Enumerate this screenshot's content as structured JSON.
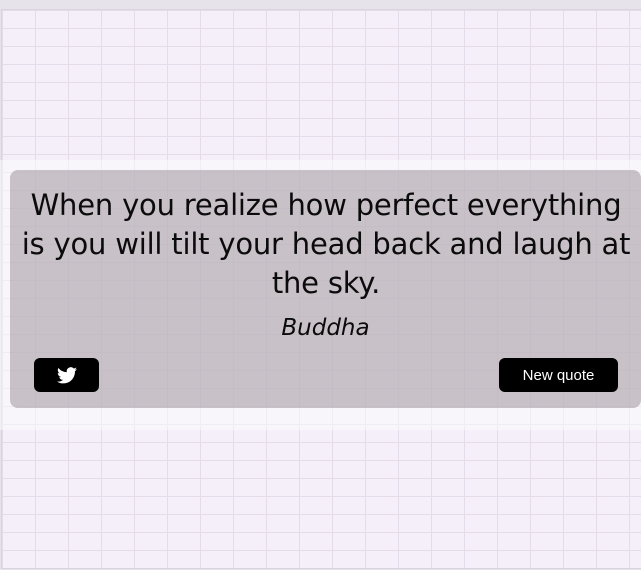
{
  "quote": {
    "text": "When you realize how perfect everything is you will tilt your head back and laugh at the sky.",
    "author": "Buddha"
  },
  "actions": {
    "tweet_icon": "twitter-icon",
    "new_quote_label": "New quote"
  },
  "colors": {
    "button_background": "#000000",
    "button_text": "#ffffff",
    "quote_box": "#aaa0a8",
    "page_background": "#f4eff8"
  }
}
